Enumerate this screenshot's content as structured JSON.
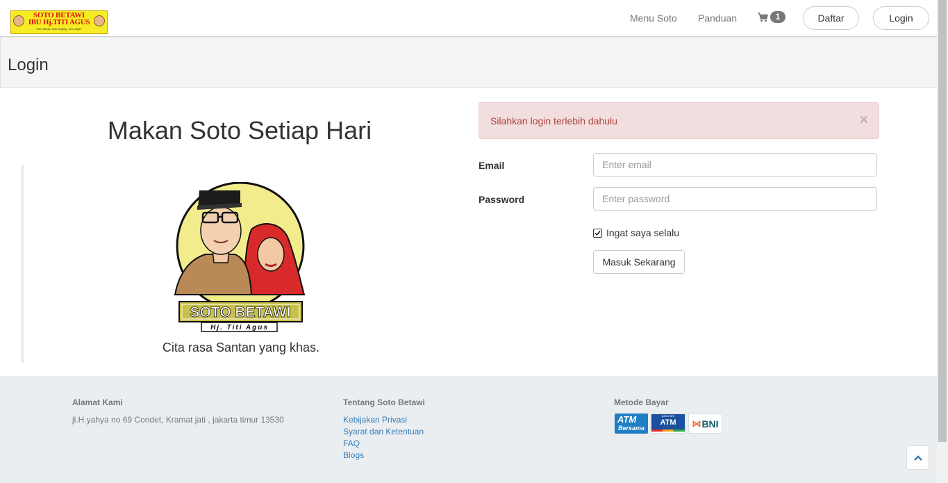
{
  "navbar": {
    "logo": {
      "line1": "SOTO BETAWI",
      "line2": "IBU Hj.TITI AGUS",
      "line3": "Soto Babat, Soto Daging, Soto Ayam"
    },
    "links": {
      "menu": "Menu Soto",
      "panduan": "Panduan"
    },
    "cart_icon": "shopping-cart-icon",
    "cart_count": "1",
    "daftar_label": "Daftar",
    "login_label": "Login"
  },
  "page_header": {
    "title": "Login"
  },
  "hero": {
    "title": "Makan Soto Setiap Hari",
    "brand": "SOTO BETAWI",
    "brand_sub": "Hj. Titi Agus",
    "tagline": "Cita rasa Santan yang khas."
  },
  "alert": {
    "message": "Silahkan login terlebih dahulu",
    "close": "×",
    "colors": {
      "background": "#f2dede",
      "border": "#ebccd1",
      "text": "#a94442"
    }
  },
  "form": {
    "email_label": "Email",
    "email_placeholder": "Enter email",
    "password_label": "Password",
    "password_placeholder": "Enter password",
    "remember_label": "Ingat saya selalu",
    "remember_checked": true,
    "submit_label": "Masuk Sekarang"
  },
  "footer": {
    "address": {
      "heading": "Alamat Kami",
      "text": "jl.H.yahya no 69 Condet, Kramat jati , jakarta timur 13530"
    },
    "about": {
      "heading": "Tentang Soto Betawi",
      "links": [
        "Kebijakan Privasi",
        "Syarat dan Ketentuan",
        "FAQ",
        "Blogs"
      ]
    },
    "payment": {
      "heading": "Metode Bayar",
      "atm_bersama": [
        "ATM",
        "Bersama"
      ],
      "bri_atm": [
        "BANK BRI",
        "ATM"
      ],
      "bni": "BNI"
    }
  },
  "scroll_top_icon": "chevron-up-icon",
  "colors": {
    "link": "#337ab7",
    "footer_bg": "#ebeef1",
    "header_bg": "#f5f5f5"
  }
}
